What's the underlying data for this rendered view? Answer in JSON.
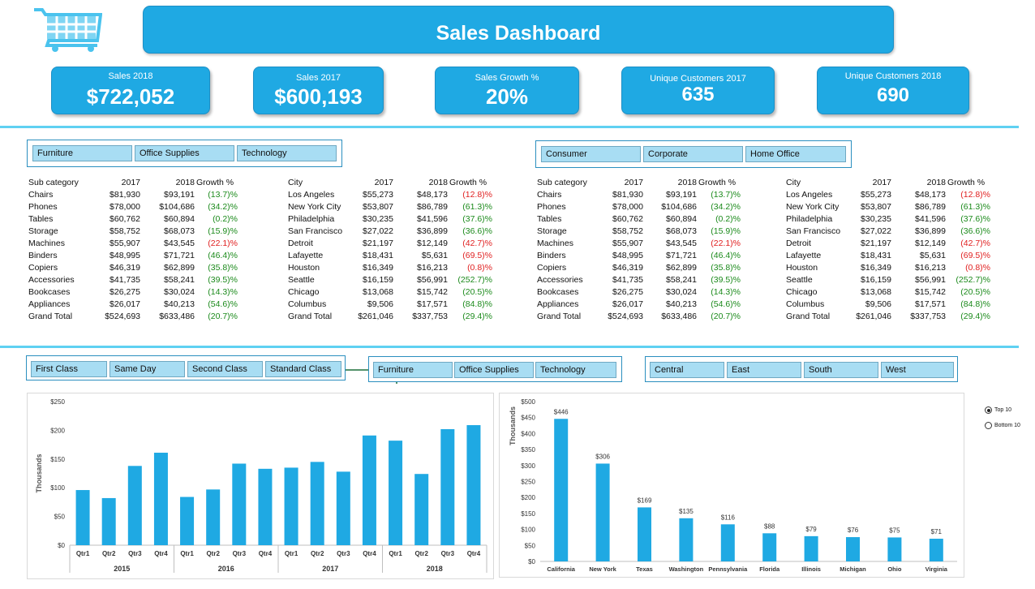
{
  "header": {
    "title": "Sales Dashboard"
  },
  "icons": {
    "cart": "shopping-cart-icon"
  },
  "colors": {
    "accent": "#1fa9e3",
    "rule": "#5fd1f2",
    "slicer_btn": "#a8ddf3",
    "bar": "#1fa9e3",
    "negative_green": "#1b8a1b",
    "negative_red": "#e02020"
  },
  "kpis": [
    {
      "label": "Sales 2018",
      "value": "$722,052"
    },
    {
      "label": "Sales 2017",
      "value": "$600,193"
    },
    {
      "label": "Sales Growth %",
      "value": "20%"
    },
    {
      "label": "Unique Customers 2017",
      "value": "635"
    },
    {
      "label": "Unique Customers 2018",
      "value": "690"
    }
  ],
  "slicers": {
    "category_top": [
      "Furniture",
      "Office Supplies",
      "Technology"
    ],
    "segment": [
      "Consumer",
      "Corporate",
      "Home Office"
    ],
    "ship_mode": [
      "First Class",
      "Same Day",
      "Second Class",
      "Standard Class"
    ],
    "category_bottom": [
      "Furniture",
      "Office Supplies",
      "Technology"
    ],
    "region": [
      "Central",
      "East",
      "South",
      "West"
    ]
  },
  "tables": {
    "subcat": {
      "headers": [
        "Sub category",
        "2017",
        "2018",
        "Growth %"
      ],
      "rows": [
        [
          "Chairs",
          "$81,930",
          "$93,191",
          "(13.7)%",
          "g"
        ],
        [
          "Phones",
          "$78,000",
          "$104,686",
          "(34.2)%",
          "g"
        ],
        [
          "Tables",
          "$60,762",
          "$60,894",
          "(0.2)%",
          "g"
        ],
        [
          "Storage",
          "$58,752",
          "$68,073",
          "(15.9)%",
          "g"
        ],
        [
          "Machines",
          "$55,907",
          "$43,545",
          "(22.1)%",
          "r"
        ],
        [
          "Binders",
          "$48,995",
          "$71,721",
          "(46.4)%",
          "g"
        ],
        [
          "Copiers",
          "$46,319",
          "$62,899",
          "(35.8)%",
          "g"
        ],
        [
          "Accessories",
          "$41,735",
          "$58,241",
          "(39.5)%",
          "g"
        ],
        [
          "Bookcases",
          "$26,275",
          "$30,024",
          "(14.3)%",
          "g"
        ],
        [
          "Appliances",
          "$26,017",
          "$40,213",
          "(54.6)%",
          "g"
        ],
        [
          "Grand Total",
          "$524,693",
          "$633,486",
          "(20.7)%",
          "g"
        ]
      ]
    },
    "city": {
      "headers": [
        "City",
        "2017",
        "2018",
        "Growth %"
      ],
      "rows": [
        [
          "Los Angeles",
          "$55,273",
          "$48,173",
          "(12.8)%",
          "r"
        ],
        [
          "New York City",
          "$53,807",
          "$86,789",
          "(61.3)%",
          "g"
        ],
        [
          "Philadelphia",
          "$30,235",
          "$41,596",
          "(37.6)%",
          "g"
        ],
        [
          "San Francisco",
          "$27,022",
          "$36,899",
          "(36.6)%",
          "g"
        ],
        [
          "Detroit",
          "$21,197",
          "$12,149",
          "(42.7)%",
          "r"
        ],
        [
          "Lafayette",
          "$18,431",
          "$5,631",
          "(69.5)%",
          "r"
        ],
        [
          "Houston",
          "$16,349",
          "$16,213",
          "(0.8)%",
          "r"
        ],
        [
          "Seattle",
          "$16,159",
          "$56,991",
          "(252.7)%",
          "g"
        ],
        [
          "Chicago",
          "$13,068",
          "$15,742",
          "(20.5)%",
          "g"
        ],
        [
          "Columbus",
          "$9,506",
          "$17,571",
          "(84.8)%",
          "g"
        ],
        [
          "Grand Total",
          "$261,046",
          "$337,753",
          "(29.4)%",
          "g"
        ]
      ]
    }
  },
  "toggle": {
    "top10": "Top 10",
    "bottom10": "Bottom 10",
    "selected": "Top 10"
  },
  "chart_data": [
    {
      "type": "bar",
      "ylabel": "Thousands",
      "ylim": [
        0,
        250
      ],
      "yticks": [
        "$0",
        "$50",
        "$100",
        "$150",
        "$200",
        "$250"
      ],
      "ytick_values": [
        0,
        50,
        100,
        150,
        200,
        250
      ],
      "groups": [
        "2015",
        "2016",
        "2017",
        "2018"
      ],
      "categories": [
        "Qtr1",
        "Qtr2",
        "Qtr3",
        "Qtr4",
        "Qtr1",
        "Qtr2",
        "Qtr3",
        "Qtr4",
        "Qtr1",
        "Qtr2",
        "Qtr3",
        "Qtr4",
        "Qtr1",
        "Qtr2",
        "Qtr3",
        "Qtr4"
      ],
      "values": [
        96,
        82,
        138,
        161,
        84,
        97,
        142,
        133,
        135,
        145,
        128,
        191,
        182,
        124,
        202,
        209
      ],
      "grid": false
    },
    {
      "type": "bar",
      "ylabel": "Thousands",
      "ylim": [
        0,
        500
      ],
      "yticks": [
        "$0",
        "$50",
        "$100",
        "$150",
        "$200",
        "$250",
        "$300",
        "$350",
        "$400",
        "$450",
        "$500"
      ],
      "ytick_values": [
        0,
        50,
        100,
        150,
        200,
        250,
        300,
        350,
        400,
        450,
        500
      ],
      "categories": [
        "California",
        "New York",
        "Texas",
        "Washington",
        "Pennsylvania",
        "Florida",
        "Illinois",
        "Michigan",
        "Ohio",
        "Virginia"
      ],
      "values": [
        446,
        306,
        169,
        135,
        116,
        88,
        79,
        76,
        75,
        71
      ],
      "data_labels": [
        "$446",
        "$306",
        "$169",
        "$135",
        "$116",
        "$88",
        "$79",
        "$76",
        "$75",
        "$71"
      ],
      "grid": false
    }
  ]
}
